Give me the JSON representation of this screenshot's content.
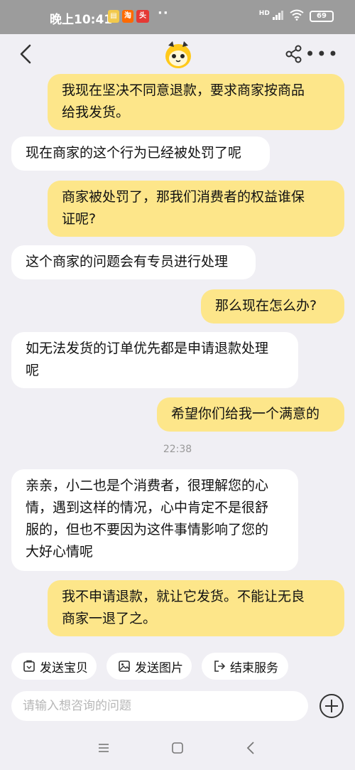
{
  "status_bar": {
    "time": "晚上10:41",
    "icons": [
      "notification-icon",
      "taobao-icon",
      "news-icon"
    ],
    "more_dots": "··",
    "signal_label": "HD",
    "battery": "69"
  },
  "header": {
    "back_icon": "chevron-left-icon",
    "avatar_icon": "mascot-avatar",
    "share_icon": "share-icon",
    "more_icon": "more-dots-icon",
    "more_label": "•••"
  },
  "messages": [
    {
      "side": "me",
      "text": "我现在坚决不同意退款，要求商家按商品\n给我发货。"
    },
    {
      "side": "them",
      "text": "现在商家的这个行为已经被处罚了呢"
    },
    {
      "side": "me",
      "text": "商家被处罚了，那我们消费者的权益谁保\n证呢?"
    },
    {
      "side": "them",
      "text": "这个商家的问题会有专员进行处理"
    },
    {
      "side": "me",
      "text": "那么现在怎么办?"
    },
    {
      "side": "them",
      "text": "如无法发货的订单优先都是申请退款处理\n呢"
    },
    {
      "side": "me",
      "text": "希望你们给我一个满意的"
    },
    {
      "side": "them",
      "text": "亲亲，小二也是个消费者，很理解您的心\n情，遇到这样的情况，心中肯定不是很舒\n服的，但也不要因为这件事情影响了您的\n大好心情呢"
    },
    {
      "side": "me",
      "text": "我不申请退款，就让它发货。不能让无良\n商家一退了之。"
    }
  ],
  "timestamp": "22:38",
  "quick_actions": [
    {
      "label": "发送宝贝",
      "icon": "product-icon"
    },
    {
      "label": "发送图片",
      "icon": "image-icon"
    },
    {
      "label": "结束服务",
      "icon": "exit-icon"
    }
  ],
  "input": {
    "placeholder": "请输入想咨询的问题",
    "value": ""
  },
  "plus_icon": "plus-circle-icon",
  "nav_bar": {
    "icons": [
      "menu-icon",
      "home-icon",
      "back-icon"
    ]
  },
  "colors": {
    "me_bubble": "#fde68a",
    "them_bubble": "#ffffff",
    "background": "#f0eff4",
    "status_bar": "#9c9c9c"
  }
}
